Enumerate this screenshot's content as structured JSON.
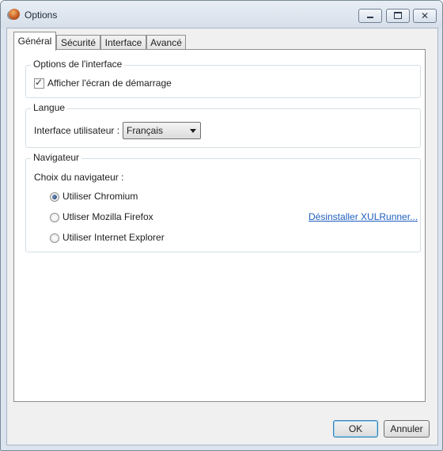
{
  "window": {
    "title": "Options",
    "icon": "app-logo-icon"
  },
  "tabs": [
    {
      "label": "Général",
      "active": true
    },
    {
      "label": "Sécurité",
      "active": false
    },
    {
      "label": "Interface",
      "active": false
    },
    {
      "label": "Avancé",
      "active": false
    }
  ],
  "interface_options": {
    "title": "Options de l'interface",
    "show_splash_label": "Afficher l'écran de démarrage",
    "show_splash_checked": true
  },
  "language": {
    "title": "Langue",
    "ui_label": "Interface utilisateur :",
    "selected": "Français"
  },
  "browser": {
    "title": "Navigateur",
    "choice_label": "Choix du navigateur :",
    "options": [
      {
        "label": "Utiliser Chromium",
        "selected": true
      },
      {
        "label": "Utliser Mozilla Firefox",
        "selected": false
      },
      {
        "label": "Utiliser Internet Explorer",
        "selected": false
      }
    ],
    "uninstall_link": "Désinstaller XULRunner..."
  },
  "buttons": {
    "ok": "OK",
    "cancel": "Annuler"
  }
}
